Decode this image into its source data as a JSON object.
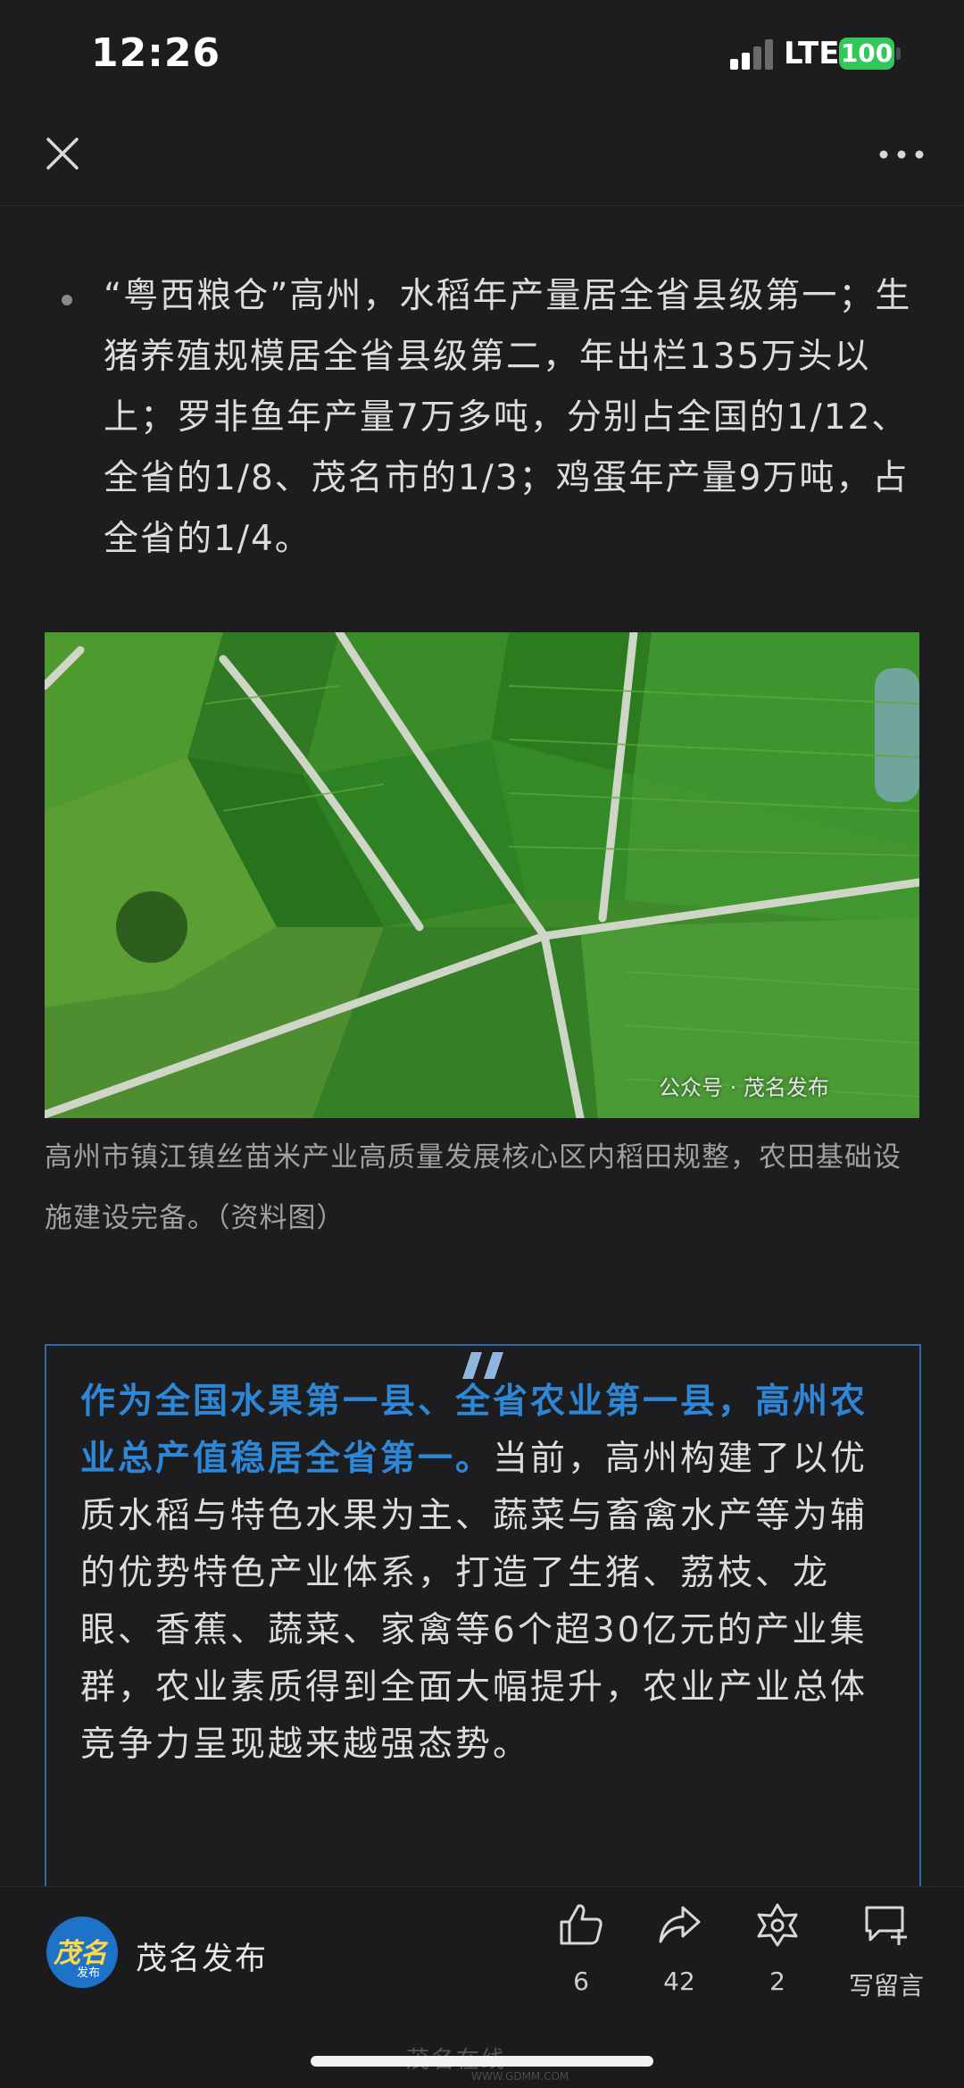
{
  "status_bar": {
    "time": "12:26",
    "network": "LTE",
    "battery": "100"
  },
  "article": {
    "bullet_text": "“粤西粮仓”高州，水稻年产量居全省县级第一；生猪养殖规模居全省县级第二，年出栏135万头以上；罗非鱼年产量7万多吨，分别占全国的1/12、全省的1/8、茂名市的1/3；鸡蛋年产量9万吨，占全省的1/4。",
    "photo_watermark": "公众号 · 茂名发布",
    "photo_caption": "高州市镇江镇丝苗米产业高质量发展核心区内稻田规整，农田基础设施建设完备。（资料图）",
    "quote_highlight": "作为全国水果第一县、全省农业第一县，高州农业总产值稳居全省第一。",
    "quote_body": "当前，高州构建了以优质水稻与特色水果为主、蔬菜与畜禽水产等为辅的优势特色产业体系，打造了生猪、荔枝、龙眼、香蕉、蔬菜、家禽等6个超30亿元的产业集群，农业素质得到全面大幅提升，农业产业总体竞争力呈现越来越强态势。"
  },
  "bottom_bar": {
    "account_avatar_text": "茂名",
    "account_avatar_sub": "发布",
    "account_name": "茂名发布",
    "like_count": "6",
    "share_count": "42",
    "wow_count": "2",
    "comment_label": "写留言"
  },
  "footer_watermark": {
    "logo_text": "茂名在线",
    "url": "WWW.GDMM.COM"
  },
  "colors": {
    "accent": "#2e86d6",
    "quote_border": "#2f6aa8",
    "background": "#1d1d1f"
  }
}
